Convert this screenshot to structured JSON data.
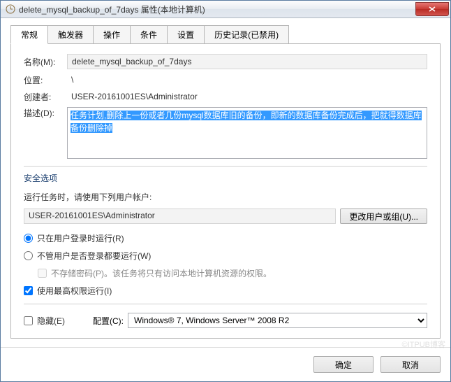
{
  "title": "delete_mysql_backup_of_7days 属性(本地计算机)",
  "tabs": [
    "常规",
    "触发器",
    "操作",
    "条件",
    "设置",
    "历史记录(已禁用)"
  ],
  "labels": {
    "name": "名称(M):",
    "location": "位置:",
    "creator": "创建者:",
    "description": "描述(D):",
    "security": "安全选项",
    "runAs": "运行任务时，请使用下列用户帐户:",
    "changeUser": "更改用户或组(U)...",
    "radio1": "只在用户登录时运行(R)",
    "radio2": "不管用户是否登录都要运行(W)",
    "noStore": "不存储密码(P)。该任务将只有访问本地计算机资源的权限。",
    "highest": "使用最高权限运行(I)",
    "hidden": "隐藏(E)",
    "configFor": "配置(C):",
    "ok": "确定",
    "cancel": "取消"
  },
  "values": {
    "name": "delete_mysql_backup_of_7days",
    "location": "\\",
    "creator": "USER-20161001ES\\Administrator",
    "description": "任务计划,删除上一份或者几份mysql数据库旧的备份，即新的数据库备份完成后，把就得数据库备份删除掉",
    "user": "USER-20161001ES\\Administrator",
    "configFor": "Windows® 7, Windows Server™ 2008 R2"
  },
  "state": {
    "runOnlyLoggedIn": true,
    "runAlways": false,
    "noStorePwd": false,
    "highestPriv": true,
    "hidden": false
  },
  "watermark": "©ITPUB博客"
}
